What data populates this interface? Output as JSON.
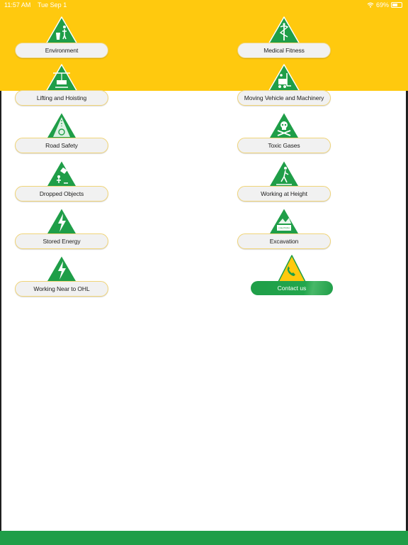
{
  "status": {
    "time": "11:57 AM",
    "date": "Tue Sep 1",
    "battery": "69%"
  },
  "tiles": [
    {
      "label": "Environment",
      "icon": "trash-bin-icon"
    },
    {
      "label": "Medical Fitness",
      "icon": "caduceus-icon"
    },
    {
      "label": "Lifting and Hoisting",
      "icon": "crane-load-icon"
    },
    {
      "label": "Moving Vehicle and Machinery",
      "icon": "forklift-icon"
    },
    {
      "label": "Road Safety",
      "icon": "road-icon"
    },
    {
      "label": "Toxic Gases",
      "icon": "skull-crossbones-icon"
    },
    {
      "label": "Dropped Objects",
      "icon": "falling-object-icon"
    },
    {
      "label": "Working at Height",
      "icon": "ladder-worker-icon"
    },
    {
      "label": "Stored Energy",
      "icon": "lightning-icon"
    },
    {
      "label": "Excavation",
      "icon": "excavation-icon"
    },
    {
      "label": "Working Near to OHL",
      "icon": "lightning-icon"
    }
  ],
  "excavation_sign_text": "CAUTION",
  "contact": {
    "label": "Contact us",
    "icon": "phone-icon"
  },
  "colors": {
    "yellow": "#ffc90e",
    "green": "#1f9e48",
    "white": "#ffffff"
  }
}
